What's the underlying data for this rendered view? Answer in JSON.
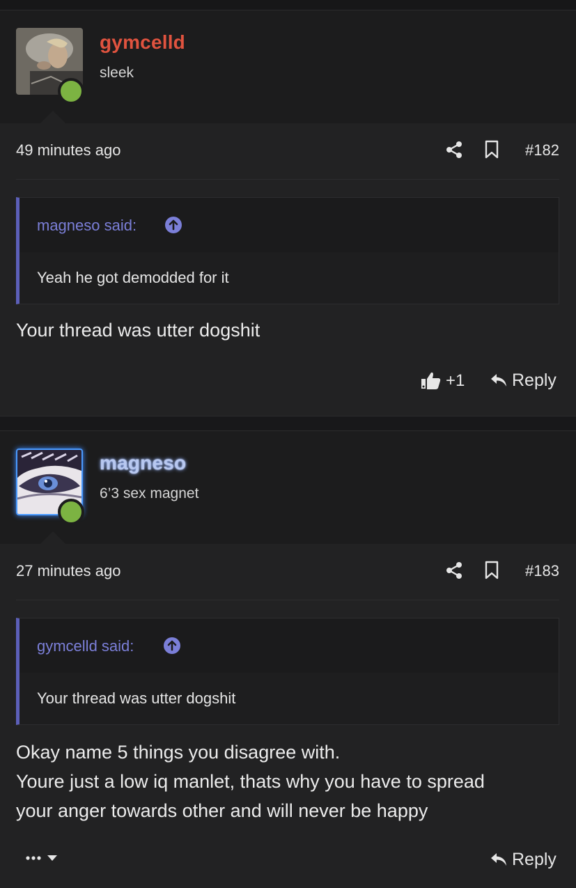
{
  "posts": [
    {
      "username": "gymcelld",
      "user_title": "sleek",
      "time": "49 minutes ago",
      "post_number": "#182",
      "quote": {
        "author": "magneso said:",
        "text": "Yeah he got demodded for it"
      },
      "message": [
        "Your thread was utter dogshit"
      ],
      "likes": "+1",
      "reply_label": "Reply"
    },
    {
      "username": "magneso",
      "user_title": "6’3 sex magnet",
      "time": "27 minutes ago",
      "post_number": "#183",
      "quote": {
        "author": "gymcelld said:",
        "text": "Your thread was utter dogshit"
      },
      "message": [
        "Okay name 5 things you disagree with.",
        "Youre just a low iq manlet, thats why you have to spread",
        "your anger towards other and will never be happy"
      ],
      "reply_label": "Reply"
    }
  ],
  "colors": {
    "username_1": "#e0533f",
    "username_2": "#b8c8f0",
    "quote_accent": "#5c5fb8",
    "online": "#7cb342"
  },
  "icons": [
    "share-icon",
    "bookmark-icon",
    "arrow-up-circle-icon",
    "thumbs-up-icon",
    "reply-arrow-icon",
    "more-dots-icon",
    "chevron-down-icon"
  ]
}
